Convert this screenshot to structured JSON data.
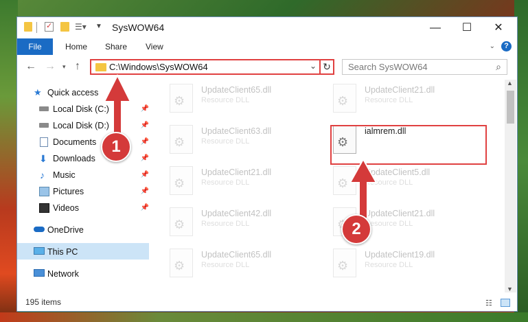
{
  "window": {
    "title": "SysWOW64",
    "minimize": "—",
    "maximize": "☐",
    "close": "✕"
  },
  "ribbon": {
    "tabs": [
      "File",
      "Home",
      "Share",
      "View"
    ],
    "help": "?"
  },
  "address": {
    "path": "C:\\Windows\\SysWOW64",
    "refresh": "↻"
  },
  "search": {
    "placeholder": "Search SysWOW64"
  },
  "sidebar": {
    "items": [
      {
        "label": "Quick access",
        "icon": "star-icon"
      },
      {
        "label": "Local Disk (C:)",
        "icon": "drive-icon",
        "pinned": true
      },
      {
        "label": "Local Disk (D:)",
        "icon": "drive-icon",
        "pinned": true
      },
      {
        "label": "Documents",
        "icon": "documents-icon",
        "pinned": true
      },
      {
        "label": "Downloads",
        "icon": "download-icon",
        "pinned": true
      },
      {
        "label": "Music",
        "icon": "music-icon",
        "pinned": true
      },
      {
        "label": "Pictures",
        "icon": "pictures-icon",
        "pinned": true
      },
      {
        "label": "Videos",
        "icon": "videos-icon",
        "pinned": true
      },
      {
        "label": "OneDrive",
        "icon": "cloud-icon"
      },
      {
        "label": "This PC",
        "icon": "computer-icon",
        "selected": true
      },
      {
        "label": "Network",
        "icon": "network-icon"
      }
    ]
  },
  "files": [
    {
      "name": "UpdateClient65.dll",
      "type": "Resource DLL"
    },
    {
      "name": "UpdateClient21.dll",
      "type": "Resource DLL"
    },
    {
      "name": "UpdateClient63.dll",
      "type": "Resource DLL"
    },
    {
      "name": "ialmrem.dll",
      "type": ""
    },
    {
      "name": "UpdateClient21.dll",
      "type": "Resource DLL"
    },
    {
      "name": "UpdateClient5.dll",
      "type": "Resource DLL"
    },
    {
      "name": "UpdateClient42.dll",
      "type": "Resource DLL"
    },
    {
      "name": "UpdateClient21.dll",
      "type": "Resource DLL"
    },
    {
      "name": "UpdateClient65.dll",
      "type": "Resource DLL"
    },
    {
      "name": "UpdateClient19.dll",
      "type": "Resource DLL"
    }
  ],
  "status": {
    "count": "195 items"
  },
  "callouts": [
    "1",
    "2"
  ],
  "colors": {
    "accent": "#1a6bc4",
    "highlight": "#e04040",
    "badge": "#d43a3a"
  }
}
